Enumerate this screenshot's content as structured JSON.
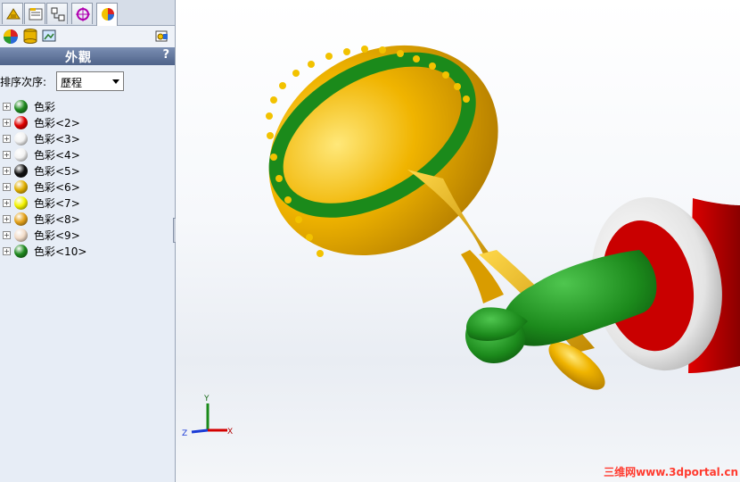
{
  "panel": {
    "title": "外觀",
    "help": "?",
    "sort_label": "排序次序:",
    "sort_value": "歷程"
  },
  "tabs": [
    {
      "icon": "feature-manager-icon"
    },
    {
      "icon": "property-manager-icon"
    },
    {
      "icon": "configuration-manager-icon"
    },
    {
      "icon": "dimxpert-icon"
    },
    {
      "icon": "appearance-manager-icon"
    }
  ],
  "colors": [
    {
      "label": "色彩",
      "color": "#1f8a1f"
    },
    {
      "label": "色彩<2>",
      "color": "#e00000"
    },
    {
      "label": "色彩<3>",
      "color": "#f2f2f2"
    },
    {
      "label": "色彩<4>",
      "color": "#f2f2f2"
    },
    {
      "label": "色彩<5>",
      "color": "#111111"
    },
    {
      "label": "色彩<6>",
      "color": "#e2b000"
    },
    {
      "label": "色彩<7>",
      "color": "#f3f300"
    },
    {
      "label": "色彩<8>",
      "color": "#e5a21a"
    },
    {
      "label": "色彩<9>",
      "color": "#f2dcc8"
    },
    {
      "label": "色彩<10>",
      "color": "#1f8a1f"
    }
  ],
  "triad": {
    "x": "X",
    "y": "Y",
    "z": "Z"
  },
  "watermark": "三维网www.3dportal.cn"
}
